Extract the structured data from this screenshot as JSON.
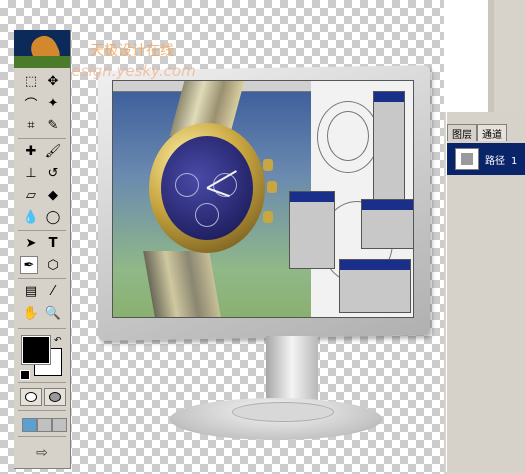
{
  "watermark": {
    "line1": "天极设计在线",
    "line2": "Design.yesky.com"
  },
  "palette": {
    "tabs": [
      "图层",
      "通道"
    ],
    "active_tab": "通道",
    "path_item": "路径 1"
  },
  "toolbox": {
    "tools": [
      "marquee-tool",
      "move-tool",
      "lasso-tool",
      "magic-wand-tool",
      "crop-tool",
      "slice-tool",
      "healing-tool",
      "brush-tool",
      "stamp-tool",
      "history-brush-tool",
      "eraser-tool",
      "paint-bucket-tool",
      "blur-tool",
      "dodge-tool",
      "path-selection-tool",
      "type-tool",
      "pen-tool",
      "shape-tool",
      "notes-tool",
      "eyedropper-tool",
      "hand-tool",
      "zoom-tool"
    ],
    "active_tool": "pen-tool",
    "type_tool_label": "T",
    "foreground_color": "#000000",
    "background_color": "#ffffff"
  }
}
